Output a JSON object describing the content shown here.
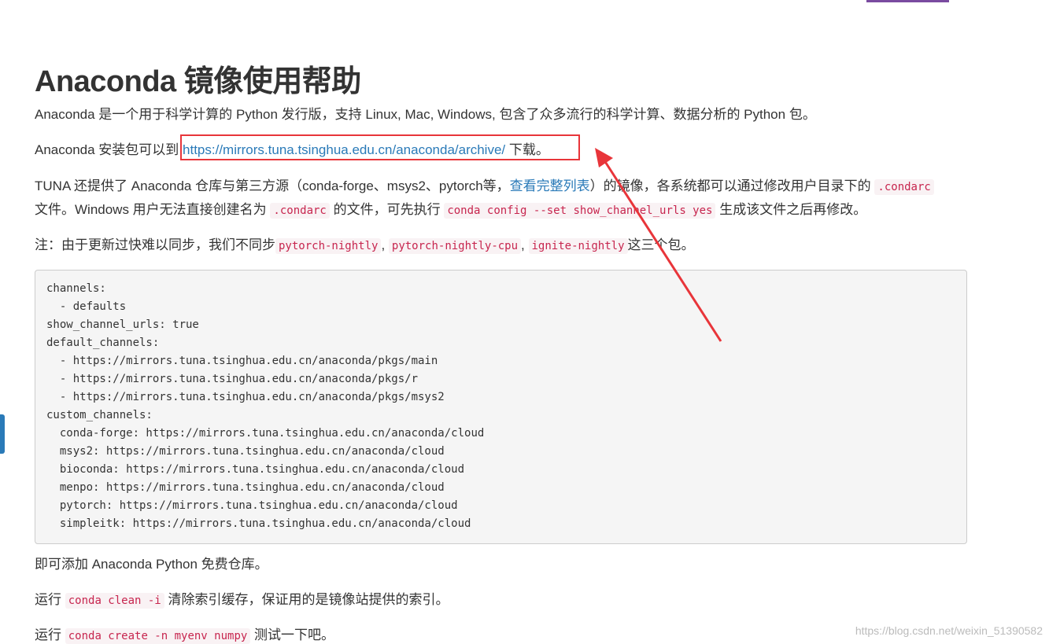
{
  "page": {
    "title": "Anaconda 镜像使用帮助",
    "intro": "Anaconda 是一个用于科学计算的 Python 发行版，支持 Linux, Mac, Windows, 包含了众多流行的科学计算、数据分析的 Python 包。",
    "download": {
      "prefix": "Anaconda 安装包可以到 ",
      "link": "https://mirrors.tuna.tsinghua.edu.cn/anaconda/archive/",
      "suffix": " 下载。"
    },
    "tuna": {
      "prefix": "TUNA 还提供了 Anaconda 仓库与第三方源（conda-forge、msys2、pytorch等，",
      "link": "查看完整列表",
      "middle": "）的镜像，各系统都可以通过修改用户目录下的 ",
      "code1": ".condarc",
      "line2_prefix": "文件。Windows 用户无法直接创建名为 ",
      "code2": ".condarc",
      "line2_middle": " 的文件，可先执行 ",
      "code3": "conda config --set show_channel_urls yes",
      "line2_suffix": " 生成该文件之后再修改。"
    },
    "note": {
      "prefix": "注：由于更新过快难以同步，我们不同步",
      "code1": "pytorch-nightly",
      "sep1": ", ",
      "code2": "pytorch-nightly-cpu",
      "sep2": ", ",
      "code3": "ignite-nightly",
      "suffix": "这三个包。"
    },
    "code_lines": [
      "channels:",
      "  - defaults",
      "show_channel_urls: true",
      "default_channels:",
      "  - https://mirrors.tuna.tsinghua.edu.cn/anaconda/pkgs/main",
      "  - https://mirrors.tuna.tsinghua.edu.cn/anaconda/pkgs/r",
      "  - https://mirrors.tuna.tsinghua.edu.cn/anaconda/pkgs/msys2",
      "custom_channels:",
      "  conda-forge: https://mirrors.tuna.tsinghua.edu.cn/anaconda/cloud",
      "  msys2: https://mirrors.tuna.tsinghua.edu.cn/anaconda/cloud",
      "  bioconda: https://mirrors.tuna.tsinghua.edu.cn/anaconda/cloud",
      "  menpo: https://mirrors.tuna.tsinghua.edu.cn/anaconda/cloud",
      "  pytorch: https://mirrors.tuna.tsinghua.edu.cn/anaconda/cloud",
      "  simpleitk: https://mirrors.tuna.tsinghua.edu.cn/anaconda/cloud"
    ],
    "after_code": "即可添加 Anaconda Python 免费仓库。",
    "clean": {
      "prefix": "运行 ",
      "code": "conda clean -i",
      "suffix": " 清除索引缓存，保证用的是镜像站提供的索引。"
    },
    "create": {
      "prefix": "运行 ",
      "code": "conda create -n myenv numpy",
      "suffix": " 测试一下吧。"
    }
  },
  "annotation": {
    "box_color": "#e8353a",
    "arrow_color": "#e8353a"
  },
  "watermark": "https://blog.csdn.net/weixin_51390582",
  "colors": {
    "link": "#2a7ab8",
    "code_text": "#c7254e",
    "code_bg": "#f9f2f4",
    "block_bg": "#f5f5f5",
    "text": "#333333"
  }
}
